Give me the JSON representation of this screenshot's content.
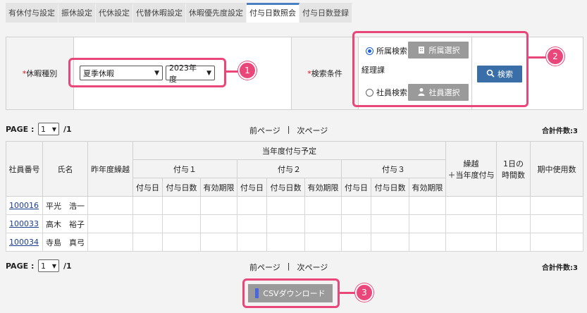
{
  "tabs": [
    {
      "label": "有休付与設定",
      "active": false
    },
    {
      "label": "振休設定",
      "active": false
    },
    {
      "label": "代休設定",
      "active": false
    },
    {
      "label": "代替休暇設定",
      "active": false
    },
    {
      "label": "休暇優先度設定",
      "active": false
    },
    {
      "label": "付与日数照会",
      "active": true
    },
    {
      "label": "付与日数登録",
      "active": false
    }
  ],
  "search": {
    "leave_type_label": "休暇種別",
    "required_mark": "*",
    "leave_type_value": "夏季休暇",
    "fiscal_year_value": "2023年度",
    "condition_label": "検索条件",
    "dept_search_label": "所属検索",
    "dept_select_button": "所属選択",
    "dept_value": "経理課",
    "employee_search_label": "社員検索",
    "employee_select_button": "社員選択",
    "search_button": "検索"
  },
  "pager": {
    "page_label": "PAGE :",
    "page_value": "1",
    "total_pages": "/1",
    "prev": "前ページ",
    "separator": "|",
    "next": "次ページ",
    "count": "合計件数:3"
  },
  "table": {
    "headers": {
      "emp_no": "社員番号",
      "name": "氏名",
      "carry_prev": "昨年度繰越",
      "plan_group": "当年度付与予定",
      "grant1": "付与１",
      "grant2": "付与２",
      "grant3": "付与３",
      "grant_date": "付与日",
      "grant_days": "付与日数",
      "expiry": "有効期限",
      "carry_plus_line1": "繰越",
      "carry_plus_line2": "＋当年度付与",
      "hours_line1": "1日の",
      "hours_line2": "時間数",
      "used": "期中使用数"
    },
    "rows": [
      {
        "emp_no": "100016",
        "name": "平光　浩一"
      },
      {
        "emp_no": "100033",
        "name": "高木　裕子"
      },
      {
        "emp_no": "100034",
        "name": "寺島　真弓"
      }
    ]
  },
  "csv_button": "CSVダウンロード",
  "callouts": [
    "1",
    "2",
    "3"
  ],
  "colors": {
    "accent": "#e9467a",
    "primary": "#3a6ea8",
    "tab_active": "#4a7fc1"
  }
}
